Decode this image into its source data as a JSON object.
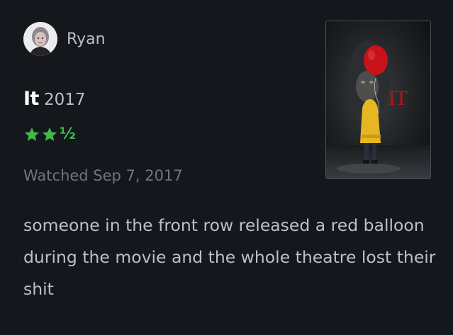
{
  "user": {
    "name": "Ryan",
    "avatar_icon": "user-avatar-portrait"
  },
  "film": {
    "title": "It",
    "year": "2017",
    "rating": 2.5,
    "rating_half_glyph": "½",
    "watched": "Watched Sep 7, 2017",
    "poster_icon": "movie-poster-it",
    "poster_logo_text": "IT"
  },
  "review": {
    "text": "someone in the front row released a red balloon during the movie and the whole theatre lost their shit"
  },
  "colors": {
    "background": "#14181c",
    "star": "#40bc4b",
    "title": "#ffffff",
    "text": "#b8c1cb",
    "muted": "#6b7784",
    "balloon": "#c8121a",
    "raincoat": "#e6b722"
  }
}
